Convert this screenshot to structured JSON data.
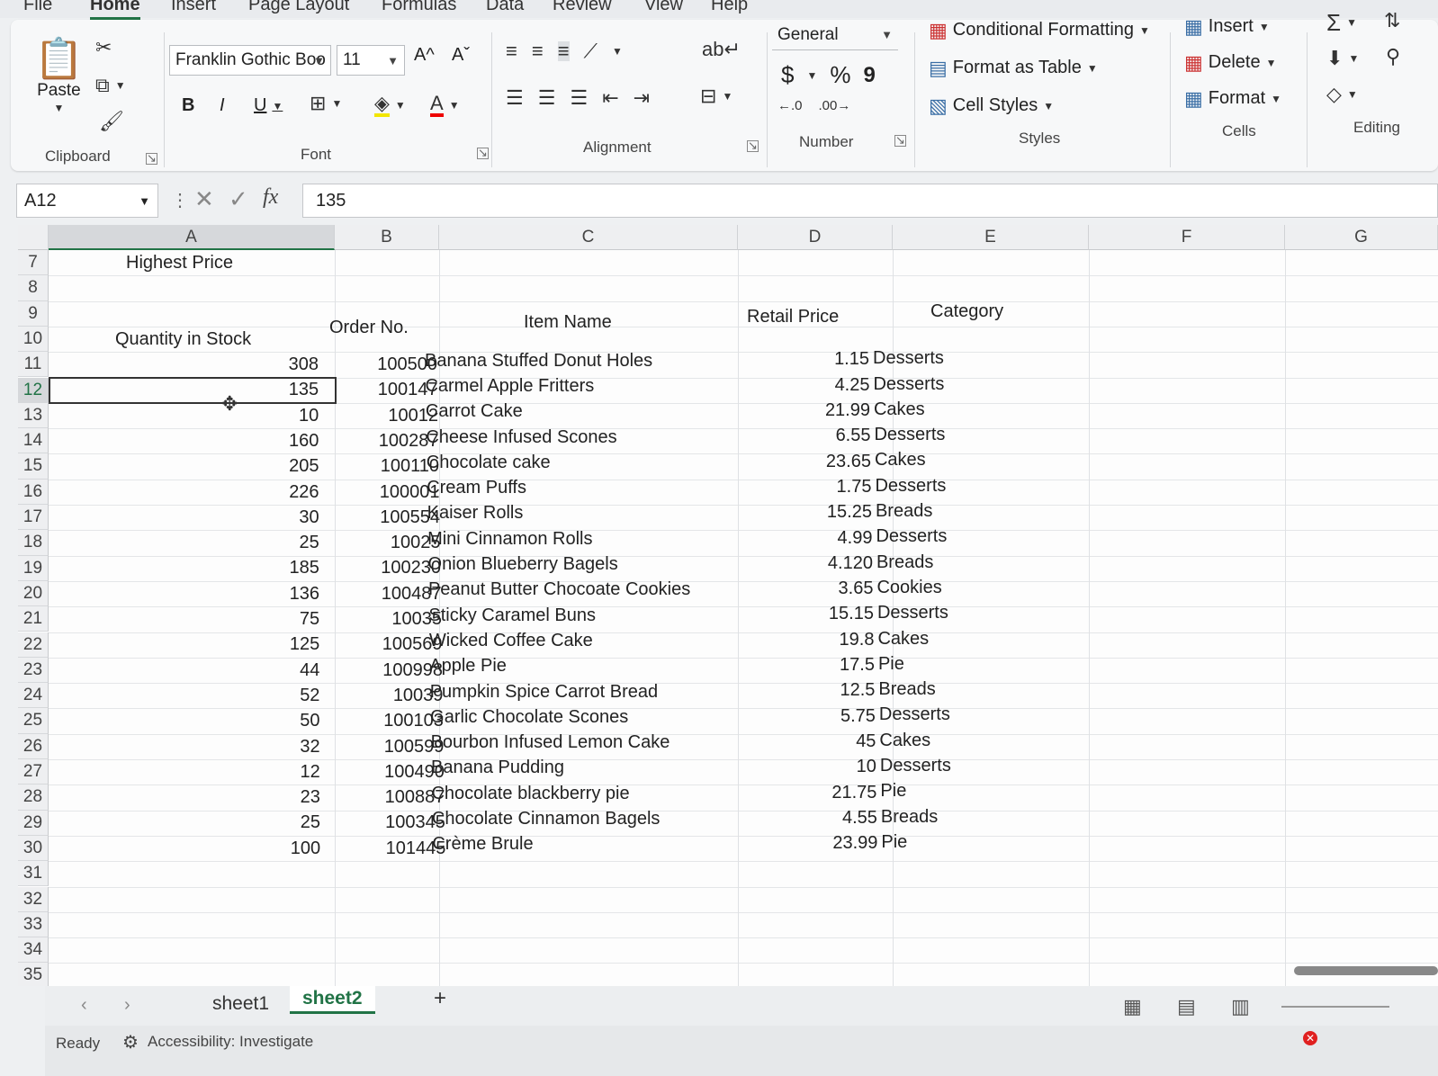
{
  "menu": [
    "File",
    "Home",
    "Insert",
    "Page Layout",
    "Formulas",
    "Data",
    "Review",
    "View",
    "Help"
  ],
  "ribbon": {
    "clipboard": {
      "paste": "Paste",
      "label": "Clipboard"
    },
    "font": {
      "name": "Franklin Gothic Boo",
      "size": "11",
      "bold": "B",
      "italic": "I",
      "underline": "U",
      "grow": "A^",
      "shrink": "Aˇ",
      "label": "Font"
    },
    "alignment": {
      "label": "Alignment"
    },
    "number": {
      "format": "General",
      "currency": "$",
      "percent": "%",
      "comma": "9",
      "label": "Number"
    },
    "styles": {
      "conditional": "Conditional Formatting",
      "table": "Format as Table",
      "cell": "Cell Styles",
      "label": "Styles"
    },
    "cells": {
      "insert": "Insert",
      "delete": "Delete",
      "format": "Format",
      "label": "Cells"
    },
    "editing": {
      "label": "Editing"
    }
  },
  "formula_bar": {
    "name_box": "A12",
    "value": "135"
  },
  "columns": [
    "A",
    "B",
    "C",
    "D",
    "E",
    "F",
    "G"
  ],
  "rows": [
    "7",
    "8",
    "9",
    "10",
    "11",
    "12",
    "13",
    "14",
    "15",
    "16",
    "17",
    "18",
    "19",
    "20",
    "21",
    "22",
    "23",
    "24",
    "25",
    "26",
    "27",
    "28",
    "29",
    "30",
    "31",
    "32",
    "33",
    "34",
    "35"
  ],
  "sheet": {
    "a7": "Highest Price",
    "headers": {
      "qty": "Quantity in Stock",
      "order": "Order No.",
      "item": "Item Name",
      "price": "Retail Price",
      "category": "Category"
    },
    "table": [
      [
        "308",
        "100500",
        "Banana Stuffed Donut Holes",
        "1.15",
        "Desserts"
      ],
      [
        "135",
        "100147",
        "Carmel Apple Fritters",
        "4.25",
        "Desserts"
      ],
      [
        "10",
        "10012",
        "Carrot Cake",
        "21.99",
        "Cakes"
      ],
      [
        "160",
        "100287",
        "Cheese Infused Scones",
        "6.55",
        "Desserts"
      ],
      [
        "205",
        "100110",
        "Chocolate cake",
        "23.65",
        "Cakes"
      ],
      [
        "226",
        "100001",
        "Cream Puffs",
        "1.75",
        "Desserts"
      ],
      [
        "30",
        "100554",
        "Kaiser Rolls",
        "15.25",
        "Breads"
      ],
      [
        "25",
        "10025",
        "Mini Cinnamon Rolls",
        "4.99",
        "Desserts"
      ],
      [
        "185",
        "100230",
        "Onion Blueberry Bagels",
        "4.120",
        "Breads"
      ],
      [
        "136",
        "100487",
        "Peanut Butter Chocoate Cookies",
        "3.65",
        "Cookies"
      ],
      [
        "75",
        "10035",
        "Sticky Caramel Buns",
        "15.15",
        "Desserts"
      ],
      [
        "125",
        "100569",
        "Wicked Coffee Cake",
        "19.8",
        "Cakes"
      ],
      [
        "44",
        "100998",
        "Apple Pie",
        "17.5",
        "Pie"
      ],
      [
        "52",
        "10039",
        "Pumpkin Spice Carrot Bread",
        "12.5",
        "Breads"
      ],
      [
        "50",
        "100103",
        "Garlic Chocolate Scones",
        "5.75",
        "Desserts"
      ],
      [
        "32",
        "100599",
        "Bourbon Infused Lemon Cake",
        "45",
        "Cakes"
      ],
      [
        "12",
        "100490",
        "Banana Pudding",
        "10",
        "Desserts"
      ],
      [
        "23",
        "100887",
        "Chocolate blackberry pie",
        "21.75",
        "Pie"
      ],
      [
        "25",
        "100345",
        "Chocolate Cinnamon Bagels",
        "4.55",
        "Breads"
      ],
      [
        "100",
        "101445",
        "Crème Brule",
        "23.99",
        "Pie"
      ]
    ]
  },
  "tabs": {
    "sheet1": "sheet1",
    "sheet2": "sheet2",
    "add": "+"
  },
  "status": {
    "ready": "Ready",
    "accessibility": "Accessibility: Investigate"
  }
}
